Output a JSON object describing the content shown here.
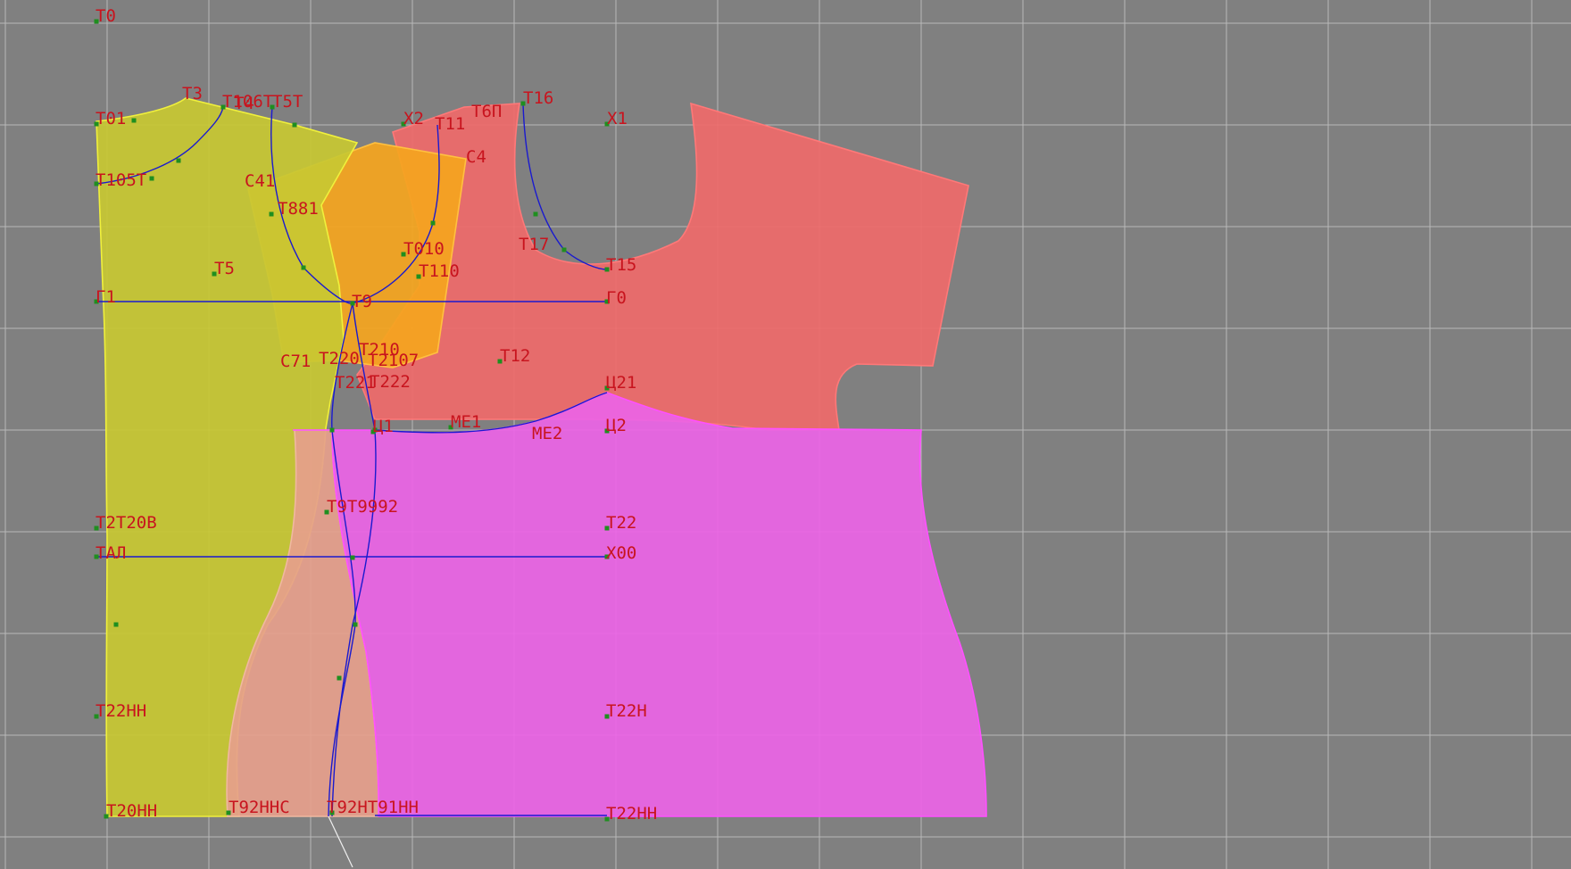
{
  "colors": {
    "background": "#808080",
    "grid": "#b8b8b8",
    "label": "#c8141e",
    "construction_line": "#1a1acf",
    "point": "#1f8f1f",
    "piece_yellow": "#c8c832",
    "piece_orange": "#f5a51e",
    "piece_salmon": "#ef6a6a",
    "piece_peach": "#e6a08c",
    "piece_magenta": "#eb64e6",
    "piece_edge_yellow": "#f0f03c",
    "piece_edge_magenta": "#ff50ff"
  },
  "labels": {
    "t0": "Т0",
    "t01": "Т01",
    "t3": "Т3",
    "t106t": "Т106Т",
    "t4": "Т4",
    "t5t": "Т5Т",
    "x2": "Х2",
    "t11": "Т11",
    "t6p": "Т6П",
    "t16": "Т16",
    "x1": "Х1",
    "c4": "С4",
    "t105t": "Т105Т",
    "c41": "С41",
    "t881": "Т881",
    "t5": "Т5",
    "t010": "Т010",
    "t110": "Т110",
    "t17": "Т17",
    "t15": "Т15",
    "g1": "Г1",
    "g0": "Г0",
    "t9": "Т9",
    "c71": "С71",
    "t220": "Т220",
    "t2107": "Т2107",
    "t210": "Т210",
    "t12": "Т12",
    "t221": "Т221",
    "t222": "Т222",
    "u21": "Ц21",
    "u1": "Ц1",
    "me1": "МЕ1",
    "me2": "МЕ2",
    "u2": "Ц2",
    "t2t20v": "Т2Т20В",
    "t91t992": "Т9Т9992",
    "t22": "Т22",
    "tal": "ТАЛ",
    "x00": "Х00",
    "t22n": "Т22Н",
    "t22ln": "Т22НН",
    "t20nn": "Т20НН",
    "t92nnc": "Т92ННС",
    "t92nt91nn": "Т92НТ91НН",
    "t22nn": "Т22НН"
  }
}
